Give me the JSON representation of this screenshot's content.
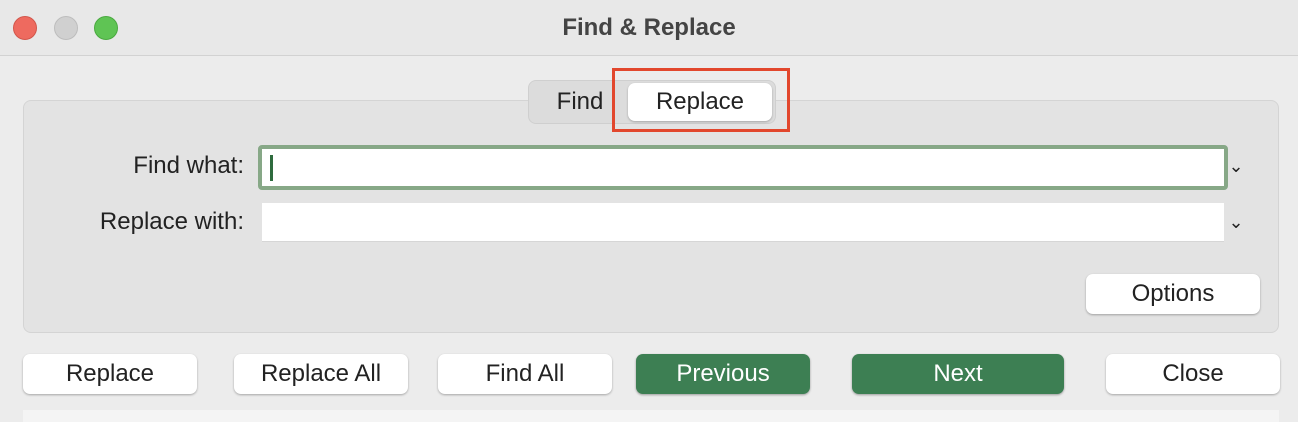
{
  "window": {
    "title": "Find & Replace"
  },
  "tabs": {
    "find": "Find",
    "replace": "Replace"
  },
  "form": {
    "find_label": "Find what:",
    "find_value": "",
    "replace_label": "Replace with:",
    "replace_value": ""
  },
  "options_label": "Options",
  "buttons": {
    "replace": "Replace",
    "replace_all": "Replace All",
    "find_all": "Find All",
    "previous": "Previous",
    "next": "Next",
    "close": "Close"
  },
  "icons": {
    "dropdown": "chevron-down-icon",
    "close": "close-window-icon",
    "minimize": "minimize-window-icon",
    "maximize": "zoom-window-icon"
  },
  "colors": {
    "primary_button": "#3d7f53",
    "highlight": "#e2472d",
    "focus_ring": "#87a887"
  }
}
